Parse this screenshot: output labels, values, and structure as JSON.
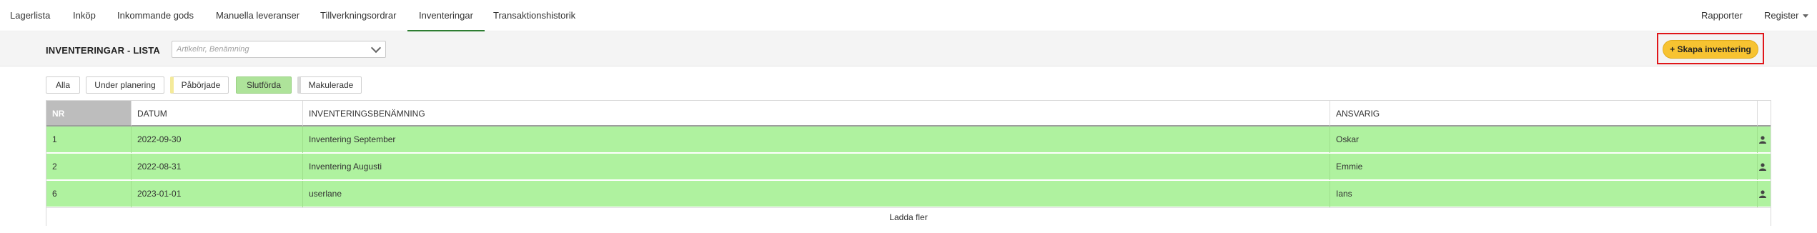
{
  "nav": {
    "items": [
      "Lagerlista",
      "Inköp",
      "Inkommande gods",
      "Manuella leveranser",
      "Tillverkningsordrar",
      "Inventeringar",
      "Transaktionshistorik"
    ],
    "active": "Inventeringar",
    "right": {
      "reports": "Rapporter",
      "register": "Register"
    }
  },
  "header": {
    "title": "INVENTERINGAR - LISTA",
    "search_placeholder": "Artikelnr, Benämning",
    "create_button": "+ Skapa inventering"
  },
  "filters": [
    "Alla",
    "Under planering",
    "Påbörjade",
    "Slutförda",
    "Makulerade"
  ],
  "active_filter": "Slutförda",
  "colors": {
    "active_nav_underline": "#2e7d32",
    "row_completed": "#aff29f",
    "create_button": "#f7c331",
    "highlight_frame": "#e0161a",
    "started_marker": "#f4ea9a"
  },
  "table": {
    "columns": [
      "NR",
      "DATUM",
      "INVENTERINGSBENÄMNING",
      "ANSVARIG"
    ],
    "rows": [
      {
        "nr": "1",
        "datum": "2022-09-30",
        "benamning": "Inventering September",
        "ansvarig": "Oskar",
        "icon": "person-icon"
      },
      {
        "nr": "2",
        "datum": "2022-08-31",
        "benamning": "Inventering Augusti",
        "ansvarig": "Emmie",
        "icon": "person-icon"
      },
      {
        "nr": "6",
        "datum": "2023-01-01",
        "benamning": "userlane",
        "ansvarig": "Ians",
        "icon": "person-icon"
      }
    ],
    "load_more": "Ladda fler"
  }
}
